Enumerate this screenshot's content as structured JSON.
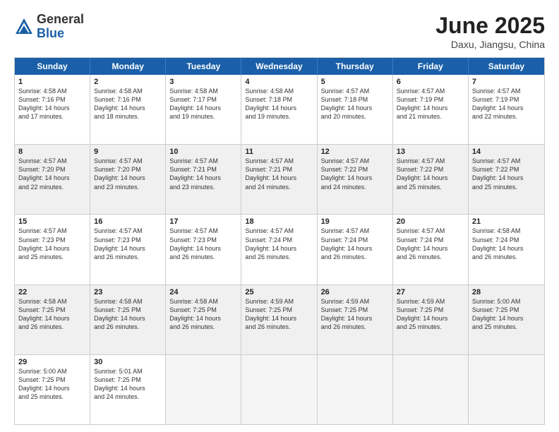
{
  "logo": {
    "general": "General",
    "blue": "Blue"
  },
  "title": "June 2025",
  "location": "Daxu, Jiangsu, China",
  "weekdays": [
    "Sunday",
    "Monday",
    "Tuesday",
    "Wednesday",
    "Thursday",
    "Friday",
    "Saturday"
  ],
  "rows": [
    [
      {
        "day": "1",
        "lines": [
          "Sunrise: 4:58 AM",
          "Sunset: 7:16 PM",
          "Daylight: 14 hours",
          "and 17 minutes."
        ]
      },
      {
        "day": "2",
        "lines": [
          "Sunrise: 4:58 AM",
          "Sunset: 7:16 PM",
          "Daylight: 14 hours",
          "and 18 minutes."
        ]
      },
      {
        "day": "3",
        "lines": [
          "Sunrise: 4:58 AM",
          "Sunset: 7:17 PM",
          "Daylight: 14 hours",
          "and 19 minutes."
        ]
      },
      {
        "day": "4",
        "lines": [
          "Sunrise: 4:58 AM",
          "Sunset: 7:18 PM",
          "Daylight: 14 hours",
          "and 19 minutes."
        ]
      },
      {
        "day": "5",
        "lines": [
          "Sunrise: 4:57 AM",
          "Sunset: 7:18 PM",
          "Daylight: 14 hours",
          "and 20 minutes."
        ]
      },
      {
        "day": "6",
        "lines": [
          "Sunrise: 4:57 AM",
          "Sunset: 7:19 PM",
          "Daylight: 14 hours",
          "and 21 minutes."
        ]
      },
      {
        "day": "7",
        "lines": [
          "Sunrise: 4:57 AM",
          "Sunset: 7:19 PM",
          "Daylight: 14 hours",
          "and 22 minutes."
        ]
      }
    ],
    [
      {
        "day": "8",
        "lines": [
          "Sunrise: 4:57 AM",
          "Sunset: 7:20 PM",
          "Daylight: 14 hours",
          "and 22 minutes."
        ],
        "shaded": true
      },
      {
        "day": "9",
        "lines": [
          "Sunrise: 4:57 AM",
          "Sunset: 7:20 PM",
          "Daylight: 14 hours",
          "and 23 minutes."
        ],
        "shaded": true
      },
      {
        "day": "10",
        "lines": [
          "Sunrise: 4:57 AM",
          "Sunset: 7:21 PM",
          "Daylight: 14 hours",
          "and 23 minutes."
        ],
        "shaded": true
      },
      {
        "day": "11",
        "lines": [
          "Sunrise: 4:57 AM",
          "Sunset: 7:21 PM",
          "Daylight: 14 hours",
          "and 24 minutes."
        ],
        "shaded": true
      },
      {
        "day": "12",
        "lines": [
          "Sunrise: 4:57 AM",
          "Sunset: 7:22 PM",
          "Daylight: 14 hours",
          "and 24 minutes."
        ],
        "shaded": true
      },
      {
        "day": "13",
        "lines": [
          "Sunrise: 4:57 AM",
          "Sunset: 7:22 PM",
          "Daylight: 14 hours",
          "and 25 minutes."
        ],
        "shaded": true
      },
      {
        "day": "14",
        "lines": [
          "Sunrise: 4:57 AM",
          "Sunset: 7:22 PM",
          "Daylight: 14 hours",
          "and 25 minutes."
        ],
        "shaded": true
      }
    ],
    [
      {
        "day": "15",
        "lines": [
          "Sunrise: 4:57 AM",
          "Sunset: 7:23 PM",
          "Daylight: 14 hours",
          "and 25 minutes."
        ]
      },
      {
        "day": "16",
        "lines": [
          "Sunrise: 4:57 AM",
          "Sunset: 7:23 PM",
          "Daylight: 14 hours",
          "and 26 minutes."
        ]
      },
      {
        "day": "17",
        "lines": [
          "Sunrise: 4:57 AM",
          "Sunset: 7:23 PM",
          "Daylight: 14 hours",
          "and 26 minutes."
        ]
      },
      {
        "day": "18",
        "lines": [
          "Sunrise: 4:57 AM",
          "Sunset: 7:24 PM",
          "Daylight: 14 hours",
          "and 26 minutes."
        ]
      },
      {
        "day": "19",
        "lines": [
          "Sunrise: 4:57 AM",
          "Sunset: 7:24 PM",
          "Daylight: 14 hours",
          "and 26 minutes."
        ]
      },
      {
        "day": "20",
        "lines": [
          "Sunrise: 4:57 AM",
          "Sunset: 7:24 PM",
          "Daylight: 14 hours",
          "and 26 minutes."
        ]
      },
      {
        "day": "21",
        "lines": [
          "Sunrise: 4:58 AM",
          "Sunset: 7:24 PM",
          "Daylight: 14 hours",
          "and 26 minutes."
        ]
      }
    ],
    [
      {
        "day": "22",
        "lines": [
          "Sunrise: 4:58 AM",
          "Sunset: 7:25 PM",
          "Daylight: 14 hours",
          "and 26 minutes."
        ],
        "shaded": true
      },
      {
        "day": "23",
        "lines": [
          "Sunrise: 4:58 AM",
          "Sunset: 7:25 PM",
          "Daylight: 14 hours",
          "and 26 minutes."
        ],
        "shaded": true
      },
      {
        "day": "24",
        "lines": [
          "Sunrise: 4:58 AM",
          "Sunset: 7:25 PM",
          "Daylight: 14 hours",
          "and 26 minutes."
        ],
        "shaded": true
      },
      {
        "day": "25",
        "lines": [
          "Sunrise: 4:59 AM",
          "Sunset: 7:25 PM",
          "Daylight: 14 hours",
          "and 26 minutes."
        ],
        "shaded": true
      },
      {
        "day": "26",
        "lines": [
          "Sunrise: 4:59 AM",
          "Sunset: 7:25 PM",
          "Daylight: 14 hours",
          "and 26 minutes."
        ],
        "shaded": true
      },
      {
        "day": "27",
        "lines": [
          "Sunrise: 4:59 AM",
          "Sunset: 7:25 PM",
          "Daylight: 14 hours",
          "and 25 minutes."
        ],
        "shaded": true
      },
      {
        "day": "28",
        "lines": [
          "Sunrise: 5:00 AM",
          "Sunset: 7:25 PM",
          "Daylight: 14 hours",
          "and 25 minutes."
        ],
        "shaded": true
      }
    ],
    [
      {
        "day": "29",
        "lines": [
          "Sunrise: 5:00 AM",
          "Sunset: 7:25 PM",
          "Daylight: 14 hours",
          "and 25 minutes."
        ]
      },
      {
        "day": "30",
        "lines": [
          "Sunrise: 5:01 AM",
          "Sunset: 7:25 PM",
          "Daylight: 14 hours",
          "and 24 minutes."
        ]
      },
      {
        "day": "",
        "lines": [],
        "empty": true
      },
      {
        "day": "",
        "lines": [],
        "empty": true
      },
      {
        "day": "",
        "lines": [],
        "empty": true
      },
      {
        "day": "",
        "lines": [],
        "empty": true
      },
      {
        "day": "",
        "lines": [],
        "empty": true
      }
    ]
  ]
}
